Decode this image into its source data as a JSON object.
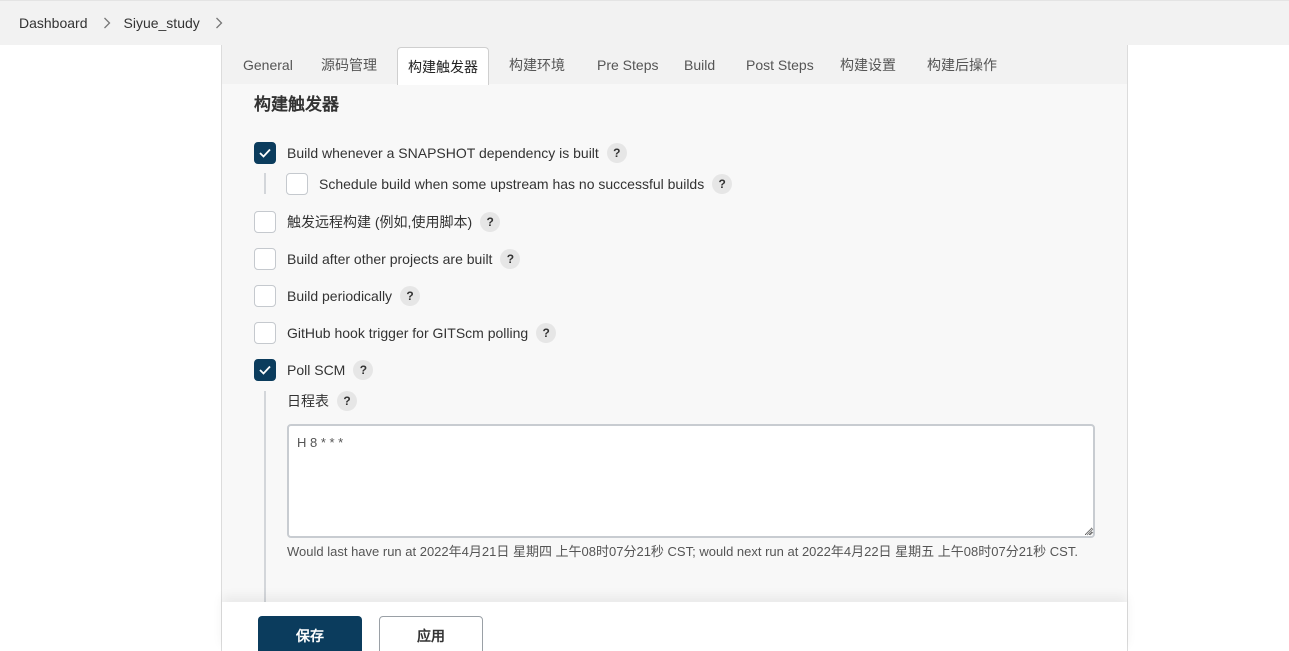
{
  "breadcrumb": {
    "items": [
      "Dashboard",
      "Siyue_study"
    ]
  },
  "tabs": [
    "General",
    "源码管理",
    "构建触发器",
    "构建环境",
    "Pre Steps",
    "Build",
    "Post Steps",
    "构建设置",
    "构建后操作"
  ],
  "active_tab": "构建触发器",
  "section_title": "构建触发器",
  "triggers": [
    {
      "label": "Build whenever a SNAPSHOT dependency is built",
      "checked": true
    },
    {
      "label": "Schedule build when some upstream has no successful builds",
      "checked": false
    },
    {
      "label": "触发远程构建 (例如,使用脚本)",
      "checked": false
    },
    {
      "label": "Build after other projects are built",
      "checked": false
    },
    {
      "label": "Build periodically",
      "checked": false
    },
    {
      "label": "GitHub hook trigger for GITScm polling",
      "checked": false
    },
    {
      "label": "Poll SCM",
      "checked": true
    }
  ],
  "help_glyph": "?",
  "schedule": {
    "label": "日程表",
    "value": "H 8 * * *"
  },
  "run_info": "Would last have run at 2022年4月21日 星期四 上午08时07分21秒 CST; would next run at 2022年4月22日 星期五 上午08时07分21秒 CST.",
  "buttons": {
    "save": "保存",
    "apply": "应用"
  },
  "colors": {
    "accent": "#0b3c5d",
    "panel_bg": "#f8f8f8",
    "breadcrumb_bg": "#f2f2f2"
  }
}
